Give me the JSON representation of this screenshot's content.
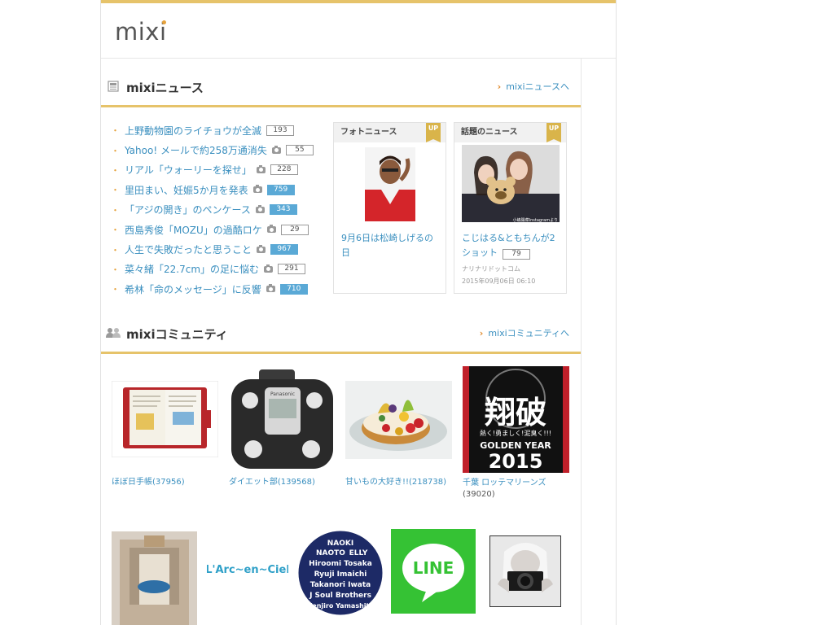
{
  "header": {
    "logo_text": "mixi"
  },
  "news": {
    "title": "mixiニュース",
    "more_link": "mixiニュースへ",
    "items": [
      {
        "title": "上野動物園のライチョウが全滅",
        "photo": false,
        "count": "193",
        "hot": false
      },
      {
        "title": "Yahoo! メールで約258万通消失",
        "photo": true,
        "count": "55",
        "hot": false
      },
      {
        "title": "リアル「ウォーリーを探せ」",
        "photo": true,
        "count": "228",
        "hot": false
      },
      {
        "title": "里田まい、妊娠5か月を発表",
        "photo": true,
        "count": "759",
        "hot": true
      },
      {
        "title": "「アジの開き」のペンケース",
        "photo": true,
        "count": "343",
        "hot": true
      },
      {
        "title": "西島秀俊「MOZU」の過酷ロケ",
        "photo": true,
        "count": "29",
        "hot": false
      },
      {
        "title": "人生で失敗だったと思うこと",
        "photo": true,
        "count": "967",
        "hot": true
      },
      {
        "title": "菜々緒「22.7cm」の足に悩む",
        "photo": true,
        "count": "291",
        "hot": false
      },
      {
        "title": "希林「命のメッセージ」に反響",
        "photo": true,
        "count": "710",
        "hot": true
      }
    ],
    "photo_news": {
      "header": "フォトニュース",
      "badge": "UP",
      "title": "9月6日は松崎しげるの日"
    },
    "topic_news": {
      "header": "話題のニュース",
      "badge": "UP",
      "title": "こじはる&ともちんが2ショット",
      "count": "79",
      "source": "ナリナリドットコム",
      "date": "2015年09月06日 06:10",
      "image_caption": "小嶋陽菜Instagramより"
    }
  },
  "community": {
    "title": "mixiコミュニティ",
    "more_link": "mixiコミュニティへ",
    "row1": [
      {
        "label": "ほぼ日手帳(37956)",
        "label2": ""
      },
      {
        "label": "ダイエット部(139568)",
        "label2": ""
      },
      {
        "label": "甘いもの大好き!!(218738)",
        "label2": ""
      },
      {
        "label": "千葉 ロッテマリーンズ",
        "label2": "(39020)"
      }
    ],
    "row2_logo_text": "L'Arc~en~Ciel",
    "line_logo_text": "LINE",
    "poster_text": {
      "main": "翔破",
      "sub": "熱く!勇ましく!泥臭く!!!",
      "golden": "GOLDEN YEAR",
      "year": "2015"
    },
    "jsb_names": [
      "NAOKI",
      "NAOTO",
      "ELLY",
      "Hiroomi Tosaka",
      "Ryuji Imaichi",
      "Takanori Iwata",
      "J Soul Brothers",
      "Kenjiro Yamashita"
    ],
    "scale_brand": "Panasonic"
  },
  "colors": {
    "accent": "#e6c36a",
    "link": "#3a8fbf",
    "hot": "#5aa9d6",
    "badge": "#d9b44a"
  }
}
